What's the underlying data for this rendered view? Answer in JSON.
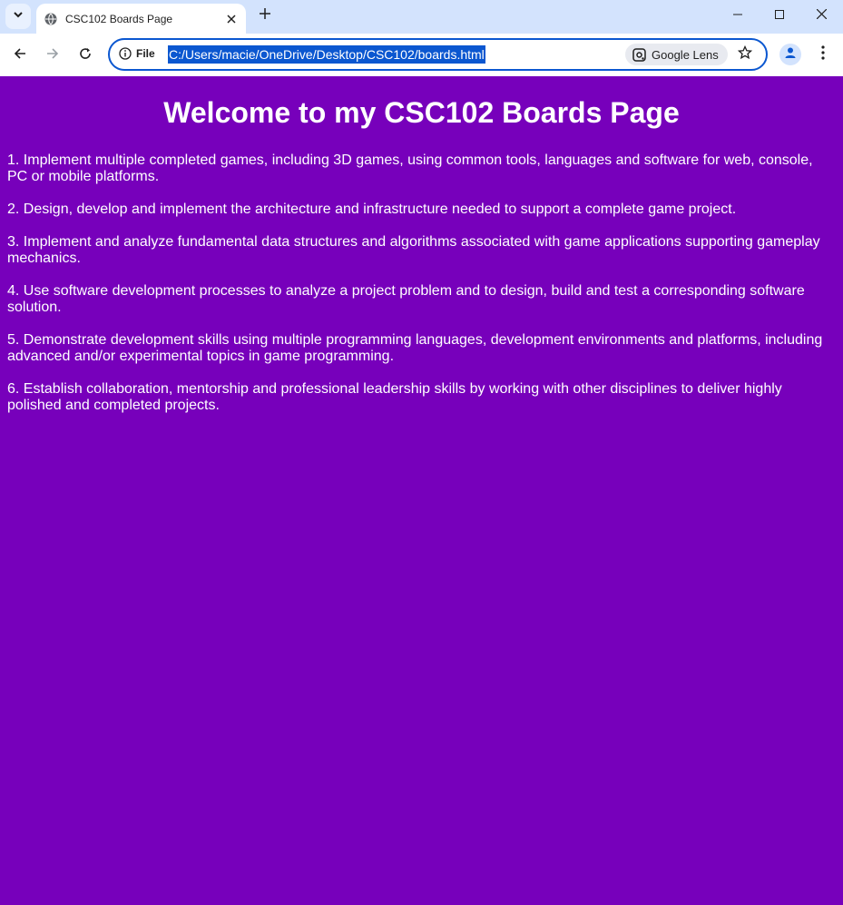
{
  "browser": {
    "tab_title": "CSC102 Boards Page",
    "address_scheme_label": "File",
    "address_url": "C:/Users/macie/OneDrive/Desktop/CSC102/boards.html",
    "lens_label": "Google Lens"
  },
  "page": {
    "heading": "Welcome to my CSC102 Boards Page",
    "items": [
      "1. Implement multiple completed games, including 3D games, using common tools, languages and software for web, console, PC or mobile platforms.",
      "2. Design, develop and implement the architecture and infrastructure needed to support a complete game project.",
      "3. Implement and analyze fundamental data structures and algorithms associated with game applications supporting gameplay mechanics.",
      "4. Use software development processes to analyze a project problem and to design, build and test a corresponding software solution.",
      "5. Demonstrate development skills using multiple programming languages, development environments and platforms, including advanced and/or experimental topics in game programming.",
      "6. Establish collaboration, mentorship and professional leadership skills by working with other disciplines to deliver highly polished and completed projects."
    ]
  },
  "colors": {
    "page_background": "#7700bb",
    "page_text": "#ffffff",
    "tabstrip": "#d3e3fd",
    "accent": "#0b57d0"
  }
}
